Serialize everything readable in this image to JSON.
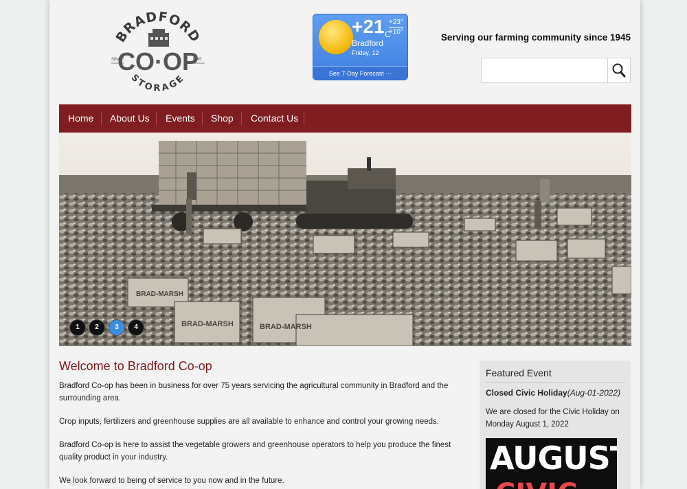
{
  "logo": {
    "top_text": "BRADFORD",
    "main_text": "CO·OP",
    "bottom_text": "STORAGE",
    "since_label": "SINCE",
    "year": "1945"
  },
  "weather": {
    "temperature": "+21",
    "unit": "° C",
    "high": "+23°",
    "low": "+10°",
    "city": "Bradford",
    "date": "Friday, 12",
    "forecast_link": "See 7-Day Forecast ···"
  },
  "header": {
    "tagline": "Serving our farming community since 1945"
  },
  "search": {
    "value": "",
    "placeholder": ""
  },
  "nav": {
    "items": [
      "Home",
      "About Us",
      "Events",
      "Shop",
      "Contact Us"
    ]
  },
  "slider": {
    "dots": [
      "1",
      "2",
      "3",
      "4"
    ],
    "active": 3,
    "crate_label": "BRAD-MARSH"
  },
  "main": {
    "heading": "Welcome to Bradford Co-op",
    "paragraphs": [
      "Bradford Co-op has been in business for over 75 years servicing the agricultural community in Bradford and the surrounding area.",
      "Crop inputs, fertilizers and greenhouse supplies are all available to enhance and control your growing needs.",
      "Bradford Co-op is here to assist the vegetable growers and greenhouse operators to help you produce the finest quality product in your industry.",
      "We look forward to being of service to you now and in the future."
    ]
  },
  "featured": {
    "heading": "Featured Event",
    "event_title": "Closed Civic Holiday",
    "event_date": "(Aug-01-2022)",
    "description": "We are closed for the Civic Holiday on Monday August 1, 2022",
    "poster_text": "AUGUST",
    "poster_text_2": "CIVIC"
  },
  "colors": {
    "brand": "#801d20",
    "slider_active": "#3a8fe0",
    "weather_bg": "#4a8ae6"
  }
}
